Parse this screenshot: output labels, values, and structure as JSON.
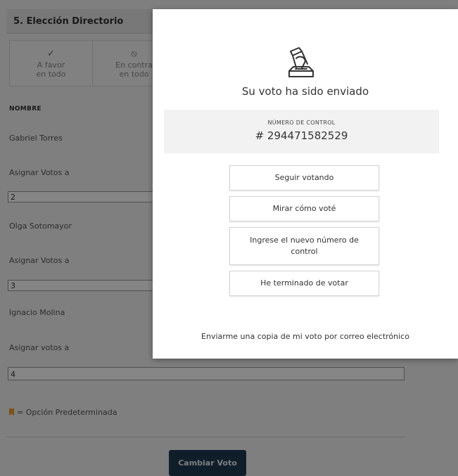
{
  "section": {
    "title": "5. Elección Directorio"
  },
  "choices": [
    {
      "icon": "✓",
      "icon_name": "check-icon",
      "line1": "A favor",
      "line2": "en todo"
    },
    {
      "icon": "⃠",
      "icon_name": "prohibited-icon",
      "line1": "En contra",
      "line2": "en todo"
    }
  ],
  "table": {
    "name_header": "NOMBRE"
  },
  "candidates": [
    {
      "name": "Gabriel Torres",
      "assign_label": "Asignar Votos a",
      "votes": "2"
    },
    {
      "name": "Olga Sotomayor",
      "assign_label": "Asignar Votos a",
      "votes": "3"
    },
    {
      "name": "Ignacio Molina",
      "assign_label": "Asignar votos a",
      "votes": "4"
    }
  ],
  "legend": {
    "text": "= Opción Predeterminada",
    "color": "#f0a02a"
  },
  "change_vote_label": "Cambiar Voto",
  "modal": {
    "icon": "ballot-box-icon",
    "title": "Su voto ha sido enviado",
    "control_label": "NÚMERO DE CONTROL",
    "control_number": "# 294471582529",
    "buttons": {
      "continue": "Seguir votando",
      "view": "Mirar cómo voté",
      "new_control": "Ingrese el nuevo número de control",
      "done": "He terminado de votar"
    },
    "email_link": "Enviarme una copia de mi voto por correo electrónico"
  }
}
